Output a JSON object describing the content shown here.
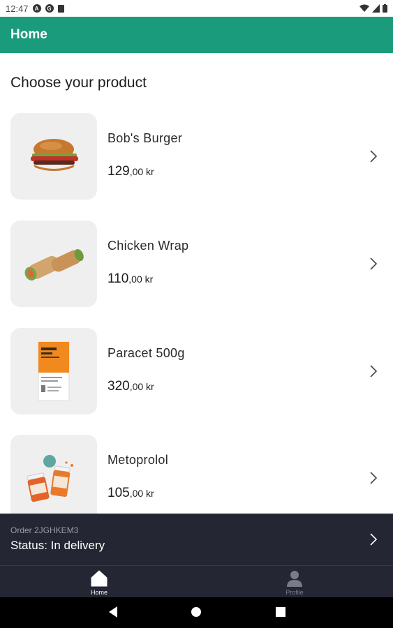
{
  "status_bar": {
    "time": "12:47"
  },
  "app_bar": {
    "title": "Home"
  },
  "main": {
    "section_title": "Choose your product",
    "products": [
      {
        "name": "Bob's Burger",
        "price_int": "129",
        "price_dec": ",00 kr"
      },
      {
        "name": "Chicken Wrap",
        "price_int": "110",
        "price_dec": ",00 kr"
      },
      {
        "name": "Paracet 500g",
        "price_int": "320",
        "price_dec": ",00 kr"
      },
      {
        "name": "Metoprolol",
        "price_int": "105",
        "price_dec": ",00 kr"
      }
    ]
  },
  "order": {
    "id_text": "Order 2JGHKEM3",
    "status_text": "Status: In delivery"
  },
  "bottom_nav": {
    "home_label": "Home",
    "profile_label": "Profile"
  },
  "colors": {
    "accent": "#1a9b7b",
    "dark_panel": "#252634",
    "thumb_bg": "#efefef"
  },
  "icons": [
    "chevron-right-icon",
    "home-icon",
    "profile-icon",
    "back-icon",
    "home-circle-icon",
    "recents-icon"
  ]
}
